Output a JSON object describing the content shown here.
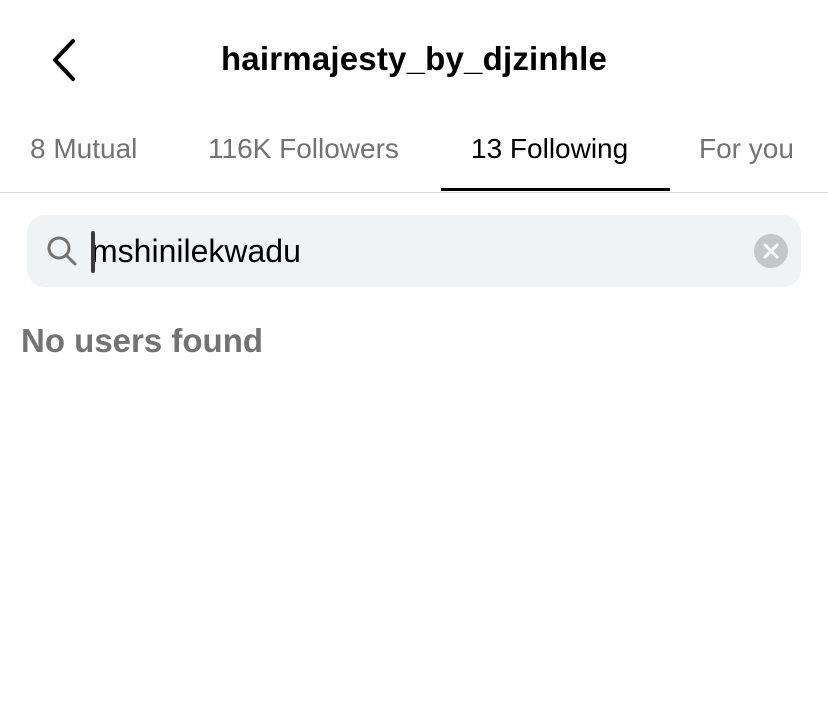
{
  "header": {
    "title": "hairmajesty_by_djzinhle",
    "back_icon": "chevron-left-icon"
  },
  "tabs": [
    {
      "label": "8 Mutual",
      "active": false
    },
    {
      "label": "116K Followers",
      "active": false
    },
    {
      "label": "13 Following",
      "active": true
    },
    {
      "label": "For you",
      "active": false
    }
  ],
  "search": {
    "value": "mshinilekwadu",
    "icon": "search-icon",
    "clear_icon": "clear-icon"
  },
  "results": {
    "empty_message": "No users found"
  },
  "colors": {
    "active_tab": "#000000",
    "inactive_tab": "#737373",
    "search_bg": "#eff3f5",
    "divider": "#dbdbdb",
    "clear_bg": "#c4c7c9"
  }
}
